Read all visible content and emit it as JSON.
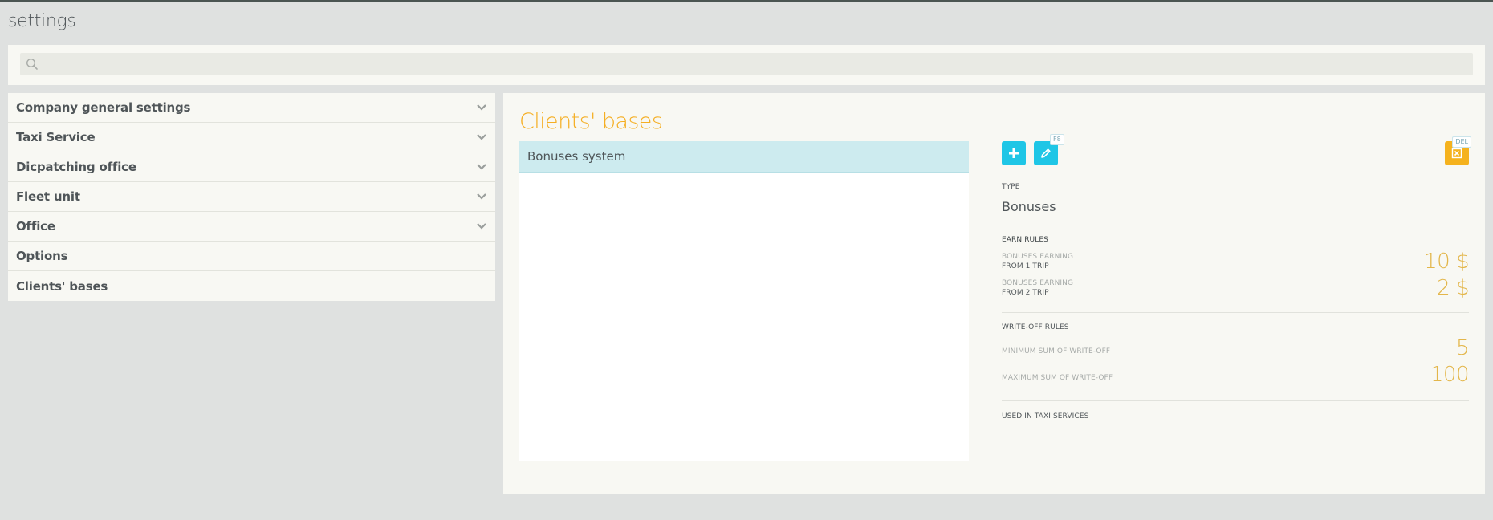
{
  "page": {
    "title": "settings"
  },
  "search": {
    "value": "",
    "placeholder": ""
  },
  "menu": {
    "items": [
      {
        "label": "Company general settings",
        "expandable": true,
        "icon": "chevron-down-icon"
      },
      {
        "label": "Taxi Service",
        "expandable": true,
        "icon": "chevron-down-icon"
      },
      {
        "label": "Dicpatching office",
        "expandable": true,
        "icon": "chevron-down-icon"
      },
      {
        "label": "Fleet unit",
        "expandable": true,
        "icon": "chevron-down-icon"
      },
      {
        "label": "Office",
        "expandable": true,
        "icon": "chevron-down-icon"
      },
      {
        "label": "Options",
        "expandable": false
      },
      {
        "label": "Clients' bases",
        "expandable": false
      }
    ]
  },
  "main": {
    "title": "Clients' bases",
    "list": [
      {
        "label": "Bonuses system",
        "selected": true
      }
    ],
    "toolbar": {
      "add_icon": "plus-icon",
      "edit_icon": "pencil-icon",
      "edit_shortcut": "F8",
      "delete_icon": "delete-icon",
      "delete_shortcut": "DEL"
    },
    "details": {
      "type_label": "TYPE",
      "type_value": "Bonuses",
      "earn_rules_label": "EARN RULES",
      "earn_rules": [
        {
          "line1": "BONUSES EARNING",
          "line2": "FROM 1 TRIP",
          "value": "10 $"
        },
        {
          "line1": "BONUSES EARNING",
          "line2": "FROM 2 TRIP",
          "value": "2 $"
        }
      ],
      "write_off_label": "WRITE-OFF RULES",
      "write_off_rules": [
        {
          "label": "MINIMUM SUM OF WRITE-OFF",
          "value": "5"
        },
        {
          "label": "MAXIMUM SUM OF WRITE-OFF",
          "value": "100"
        }
      ],
      "used_in_label": "USED IN TAXI SERVICES"
    }
  },
  "colors": {
    "background": "#dfe1e0",
    "panel": "#f8f8f3",
    "accent_orange": "#f5ae22",
    "accent_cyan": "#1fc6e6",
    "selected_row": "#cdebef",
    "value_gold": "#e3b64a"
  }
}
